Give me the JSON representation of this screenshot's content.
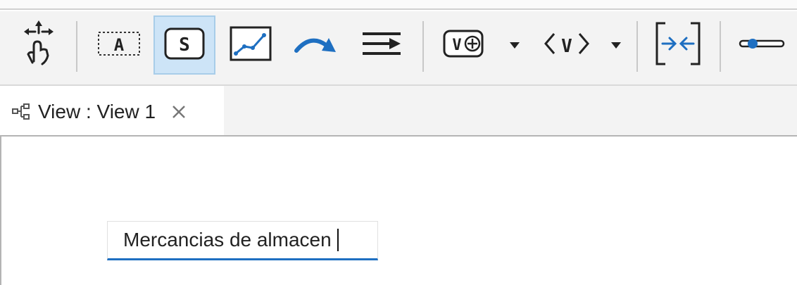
{
  "toolbar": {
    "items": [
      {
        "icon": "touch-move-icon"
      },
      {
        "icon": "text-label-icon",
        "glyph": "A"
      },
      {
        "icon": "stock-icon",
        "glyph": "S",
        "selected": true
      },
      {
        "icon": "graph-chart-icon"
      },
      {
        "icon": "flow-arrow-icon"
      },
      {
        "icon": "flow-align-icon"
      },
      {
        "icon": "variable-add-icon",
        "glyph": "V⊕",
        "has_dropdown": true
      },
      {
        "icon": "variable-reference-icon",
        "glyph": "⟨V⟩",
        "has_dropdown": true
      },
      {
        "icon": "merge-arrows-icon"
      },
      {
        "icon": "slider-icon"
      }
    ]
  },
  "tab": {
    "icon": "view-diagram-icon",
    "title": "View : View 1",
    "close_icon": "close-icon"
  },
  "canvas": {
    "edit_box": {
      "value": "Mercancias de almacen"
    }
  },
  "colors": {
    "accent": "#1e6fc1",
    "selected_bg": "#cde4f7",
    "toolbar_bg": "#f3f3f3"
  }
}
